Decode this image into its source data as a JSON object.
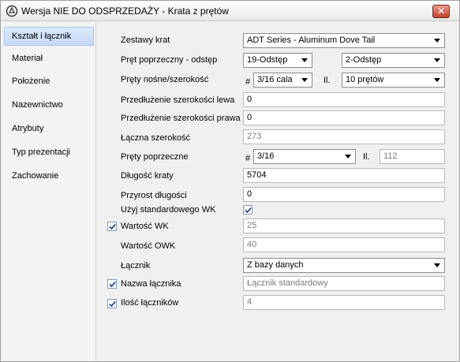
{
  "window": {
    "title": "Wersja NIE DO ODSPRZEDAŻY - Krata z prętów",
    "close_glyph": "✕"
  },
  "sidebar": {
    "items": [
      {
        "label": "Kształt i łącznik"
      },
      {
        "label": "Materiał"
      },
      {
        "label": "Położenie"
      },
      {
        "label": "Nazewnictwo"
      },
      {
        "label": "Atrybuty"
      },
      {
        "label": "Typ prezentacji"
      },
      {
        "label": "Zachowanie"
      }
    ]
  },
  "form": {
    "zestawy_krat": {
      "label": "Zestawy krat",
      "value": "ADT Series - Aluminum Dove Tail"
    },
    "pret_poprzeczny_odstep": {
      "label": "Pręt poprzeczny - odstęp",
      "value1": "19-Odstęp",
      "value2": "2-Odstęp"
    },
    "prety_nosne": {
      "label": "Pręty nośne/szerokość",
      "hash": "#",
      "size": "3/16 cala",
      "count_label": "Il.",
      "count": "10 prętów"
    },
    "przedluzenie_lewa": {
      "label": "Przedłużenie szerokości lewa",
      "value": "0"
    },
    "przedluzenie_prawa": {
      "label": "Przedłużenie szerokości prawa",
      "value": "0"
    },
    "laczna_szerokosc": {
      "label": "Łączna szerokość",
      "value": "273"
    },
    "prety_poprzeczne": {
      "label": "Pręty poprzeczne",
      "hash": "#",
      "size": "3/16",
      "count_label": "Il.",
      "count": "112"
    },
    "dlugosc_kraty": {
      "label": "Długość kraty",
      "value": "5704"
    },
    "przyrost_dlugosci": {
      "label": "Przyrost długości",
      "value": "0"
    },
    "uzyj_wk": {
      "label": "Użyj standardowego WK",
      "checked": true
    },
    "wartosc_wk": {
      "label": "Wartość WK",
      "value": "25",
      "checked": true
    },
    "wartosc_owk": {
      "label": "Wartość OWK",
      "value": "40"
    },
    "lacznik": {
      "label": "Łącznik",
      "value": "Z bazy danych"
    },
    "nazwa_lacznika": {
      "label": "Nazwa łącznika",
      "value": "Łącznik standardowy",
      "checked": true
    },
    "ilosc_lacznikow": {
      "label": "Ilość łączników",
      "value": "4",
      "checked": true
    }
  },
  "colors": {
    "selection": "#c5daf6",
    "window_bg": "#f0f0f0",
    "readonly_text": "#7a7a7a"
  }
}
